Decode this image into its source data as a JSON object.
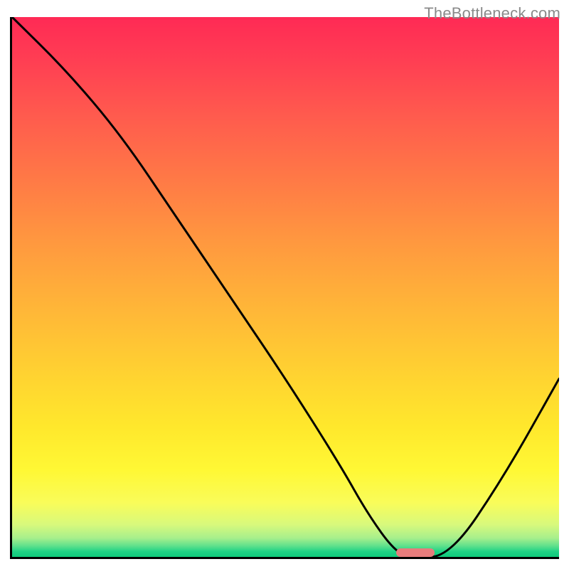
{
  "watermark": "TheBottleneck.com",
  "colors": {
    "axis": "#000000",
    "curve": "#000000",
    "marker": "#e77c7c",
    "gradient_top": "#ff2a55",
    "gradient_bottom": "#0fc97b"
  },
  "chart_data": {
    "type": "line",
    "title": "",
    "xlabel": "",
    "ylabel": "",
    "xlim": [
      0,
      100
    ],
    "ylim": [
      0,
      100
    ],
    "grid": false,
    "legend": false,
    "series": [
      {
        "name": "bottleneck-curve",
        "x": [
          0,
          10,
          20,
          30,
          40,
          50,
          60,
          65,
          70,
          73,
          80,
          90,
          100
        ],
        "y": [
          100,
          90,
          78,
          63,
          48,
          33,
          17,
          8,
          1,
          0,
          0,
          15,
          33
        ]
      }
    ],
    "marker": {
      "x_start": 70,
      "x_end": 77,
      "y": 0
    }
  }
}
